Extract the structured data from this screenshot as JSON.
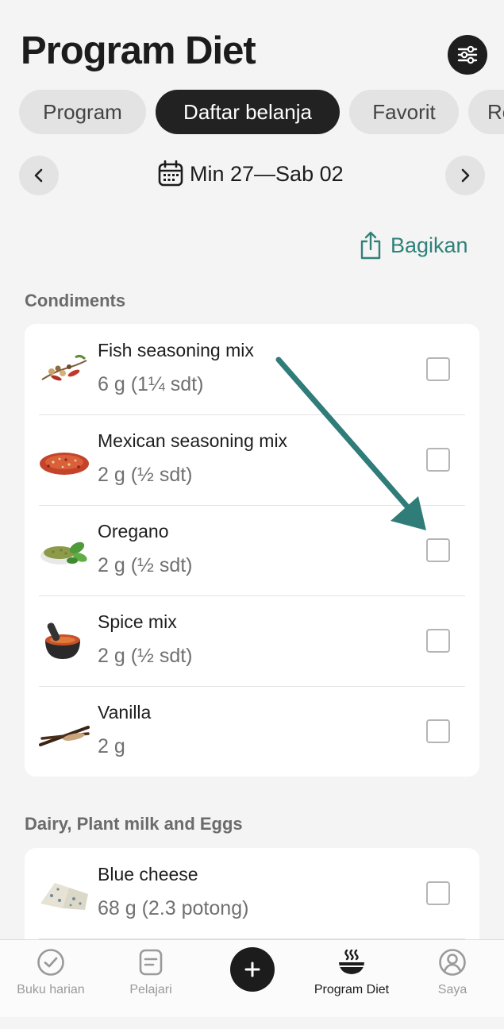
{
  "header": {
    "title": "Program Diet"
  },
  "tabs": [
    "Program",
    "Daftar belanja",
    "Favorit",
    "Re"
  ],
  "active_tab": 1,
  "date_range": "Min 27—Sab 02",
  "share_label": "Bagikan",
  "sections": [
    {
      "title": "Condiments",
      "items": [
        {
          "name": "Fish seasoning mix",
          "qty": "6 g (1¼ sdt)",
          "thumb": "fish-seasoning-mix-image",
          "checked": false
        },
        {
          "name": "Mexican seasoning mix",
          "qty": "2 g (½ sdt)",
          "thumb": "mexican-seasoning-mix-image",
          "checked": false
        },
        {
          "name": "Oregano",
          "qty": "2 g (½ sdt)",
          "thumb": "oregano-image",
          "checked": false
        },
        {
          "name": "Spice mix",
          "qty": "2 g (½ sdt)",
          "thumb": "spice-mix-image",
          "checked": false
        },
        {
          "name": "Vanilla",
          "qty": "2 g",
          "thumb": "vanilla-image",
          "checked": false
        }
      ]
    },
    {
      "title": "Dairy, Plant milk and Eggs",
      "items": [
        {
          "name": "Blue cheese",
          "qty": "68 g (2.3 potong)",
          "thumb": "blue-cheese-image",
          "checked": false
        }
      ]
    }
  ],
  "bottom_nav": {
    "items": [
      {
        "label": "Buku harian",
        "icon": "check-circle-icon",
        "active": false
      },
      {
        "label": "Pelajari",
        "icon": "document-icon",
        "active": false
      },
      {
        "label": "",
        "icon": "plus-icon",
        "active": false
      },
      {
        "label": "Program Diet",
        "icon": "bowl-icon",
        "active": true
      },
      {
        "label": "Saya",
        "icon": "user-icon",
        "active": false
      }
    ]
  },
  "colors": {
    "accent": "#2f8179",
    "arrow": "#2f7c78",
    "dark": "#1e1e1e"
  }
}
